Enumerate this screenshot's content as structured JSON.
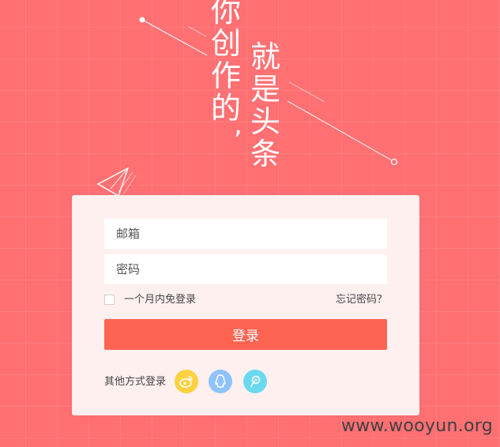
{
  "slogan": {
    "left_chars": [
      "你",
      "创",
      "作",
      "的"
    ],
    "comma": ",",
    "right_chars": [
      "就",
      "是",
      "头",
      "条"
    ]
  },
  "login_form": {
    "email_placeholder": "邮箱",
    "password_placeholder": "密码",
    "remember_label": "一个月内免登录",
    "remember_checked": false,
    "forgot_label": "忘记密码？",
    "submit_label": "登录"
  },
  "social_login": {
    "label": "其他方式登录",
    "providers": [
      {
        "name": "weibo-icon",
        "color": "#ffd03f"
      },
      {
        "name": "qq-icon",
        "color": "#8fc3fb"
      },
      {
        "name": "tencent-weibo-icon",
        "color": "#6ad9ed"
      }
    ]
  },
  "watermark": "www.wooyun.org",
  "colors": {
    "background": "#ff7073",
    "card": "#fff0f0",
    "primary_button": "#ff6352"
  }
}
